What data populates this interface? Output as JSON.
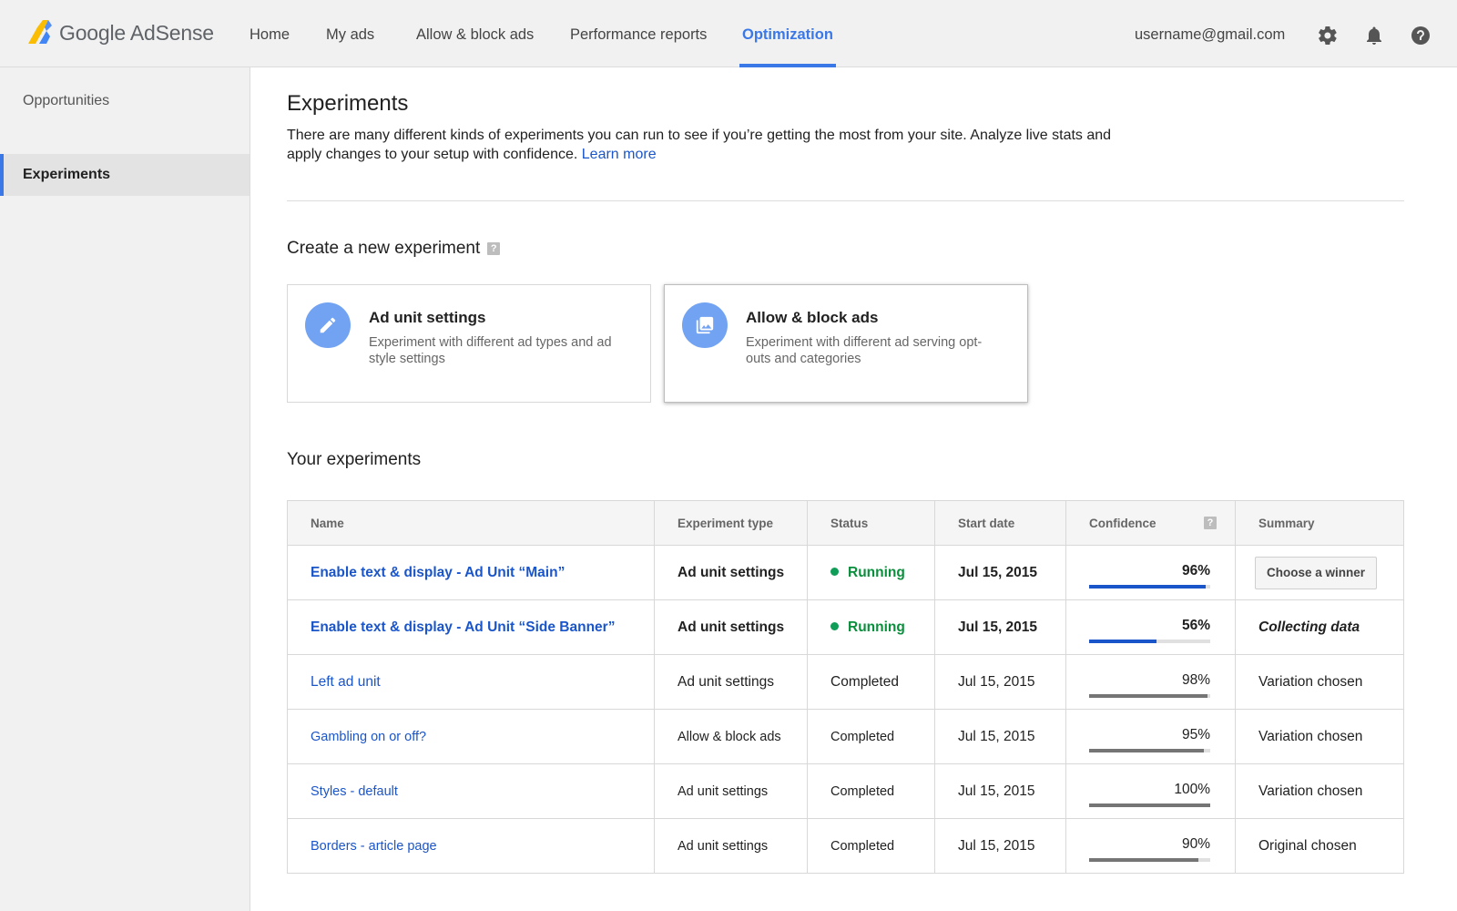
{
  "brand": {
    "name": "Google AdSense"
  },
  "nav": {
    "items": [
      {
        "label": "Home"
      },
      {
        "label": "My ads"
      },
      {
        "label": "Allow & block ads"
      },
      {
        "label": "Performance reports"
      },
      {
        "label": "Optimization"
      }
    ],
    "active": "Optimization"
  },
  "user": {
    "email": "username@gmail.com"
  },
  "icons": {
    "settings": "gear-icon",
    "notifications": "bell-icon",
    "help": "help-circle-icon"
  },
  "sidebar": {
    "items": [
      {
        "label": "Opportunities"
      },
      {
        "label": "Experiments"
      }
    ],
    "active": "Experiments"
  },
  "page": {
    "title": "Experiments",
    "intro": "There are many different kinds of experiments you can run to see if you’re getting the most from your site. Analyze live stats and apply changes to your setup with confidence.",
    "learn_more": "Learn more"
  },
  "create": {
    "title": "Create a new experiment",
    "help_glyph": "?",
    "cards": [
      {
        "title": "Ad unit settings",
        "desc": "Experiment with different ad types and ad style settings",
        "icon": "pencil-icon"
      },
      {
        "title": "Allow & block ads",
        "desc": "Experiment with different ad serving opt-outs and categories",
        "icon": "image-icon"
      }
    ]
  },
  "experiments": {
    "title": "Your experiments",
    "columns": [
      "Name",
      "Experiment type",
      "Status",
      "Start date",
      "Confidence",
      "Summary"
    ],
    "rows": [
      {
        "name": "Enable text & display - Ad Unit “Main”",
        "type": "Ad unit settings",
        "status": "Running",
        "start": "Jul 15, 2015",
        "confidence": "96%",
        "confidence_fraction": 0.96,
        "summary": "Choose a winner"
      },
      {
        "name": "Enable text & display - Ad Unit “Side Banner”",
        "type": "Ad unit settings",
        "status": "Running",
        "start": "Jul 15, 2015",
        "confidence": "56%",
        "confidence_fraction": 0.56,
        "summary": "Collecting data"
      },
      {
        "name": "Left ad unit",
        "type": "Ad unit settings",
        "status": "Completed",
        "start": "Jul 15, 2015",
        "confidence": "98%",
        "confidence_fraction": 0.98,
        "summary": "Variation chosen"
      },
      {
        "name": "Gambling on or off?",
        "type": "Allow & block ads",
        "status": "Completed",
        "start": "Jul 15, 2015",
        "confidence": "95%",
        "confidence_fraction": 0.95,
        "summary": "Variation chosen"
      },
      {
        "name": "Styles - default",
        "type": "Ad unit settings",
        "status": "Completed",
        "start": "Jul 15, 2015",
        "confidence": "100%",
        "confidence_fraction": 1.0,
        "summary": "Variation chosen"
      },
      {
        "name": "Borders - article page",
        "type": "Ad unit settings",
        "status": "Completed",
        "start": "Jul 15, 2015",
        "confidence": "90%",
        "confidence_fraction": 0.9,
        "summary": "Original chosen"
      }
    ]
  },
  "colors": {
    "accent": "#3b78e7",
    "link": "#1a55c9",
    "running": "#0a8f3c",
    "bar_running": "#1a55c9",
    "bar_completed": "#757575",
    "card_icon": "#72a3f2"
  }
}
